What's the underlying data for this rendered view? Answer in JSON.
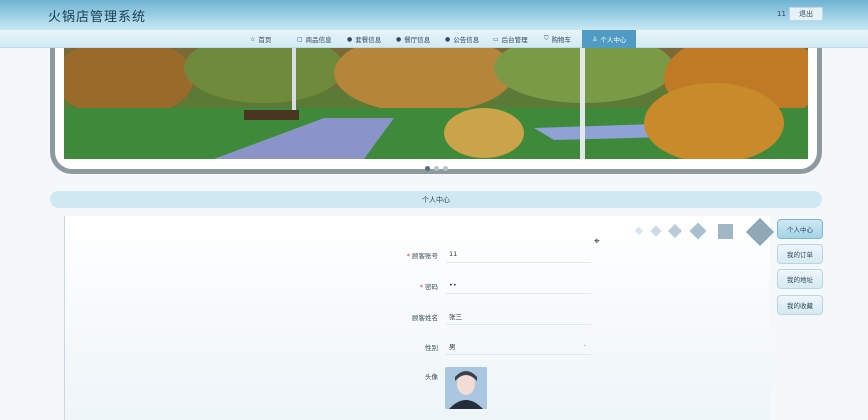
{
  "header": {
    "title": "火锅店管理系统",
    "username": "11",
    "logout_label": "退出"
  },
  "nav": {
    "items": [
      {
        "label": "首页",
        "icon": "home-icon"
      },
      {
        "label": "商品信息",
        "icon": "box-icon"
      },
      {
        "label": "套餐信息",
        "icon": "info-icon"
      },
      {
        "label": "餐厅信息",
        "icon": "info-icon"
      },
      {
        "label": "公告信息",
        "icon": "info-icon"
      },
      {
        "label": "后台管理",
        "icon": "admin-icon"
      },
      {
        "label": "购物车",
        "icon": "cart-icon"
      },
      {
        "label": "个人中心",
        "icon": "user-icon"
      }
    ],
    "active": "个人中心"
  },
  "carousel": {
    "image": "autumn-park-banner",
    "slide_count": 3,
    "active_slide": 1
  },
  "section": {
    "title": "个人中心"
  },
  "form": {
    "account": {
      "label": "顾客账号",
      "required": true,
      "value": "11"
    },
    "password": {
      "label": "密码",
      "required": true,
      "value": "••"
    },
    "name": {
      "label": "顾客姓名",
      "required": false,
      "value": "张三"
    },
    "gender": {
      "label": "性别",
      "required": false,
      "value": "男"
    },
    "avatar": {
      "label": "头像",
      "image": "user-avatar-photo"
    }
  },
  "side_menu": {
    "items": [
      {
        "label": "个人中心",
        "active": true
      },
      {
        "label": "我的订单",
        "active": false
      },
      {
        "label": "我的地址",
        "active": false
      },
      {
        "label": "我的收藏",
        "active": false
      }
    ]
  },
  "colors": {
    "accent": "#4f9bc3",
    "header_bg": "#9fd1e6",
    "required_mark": "#dd3333"
  }
}
